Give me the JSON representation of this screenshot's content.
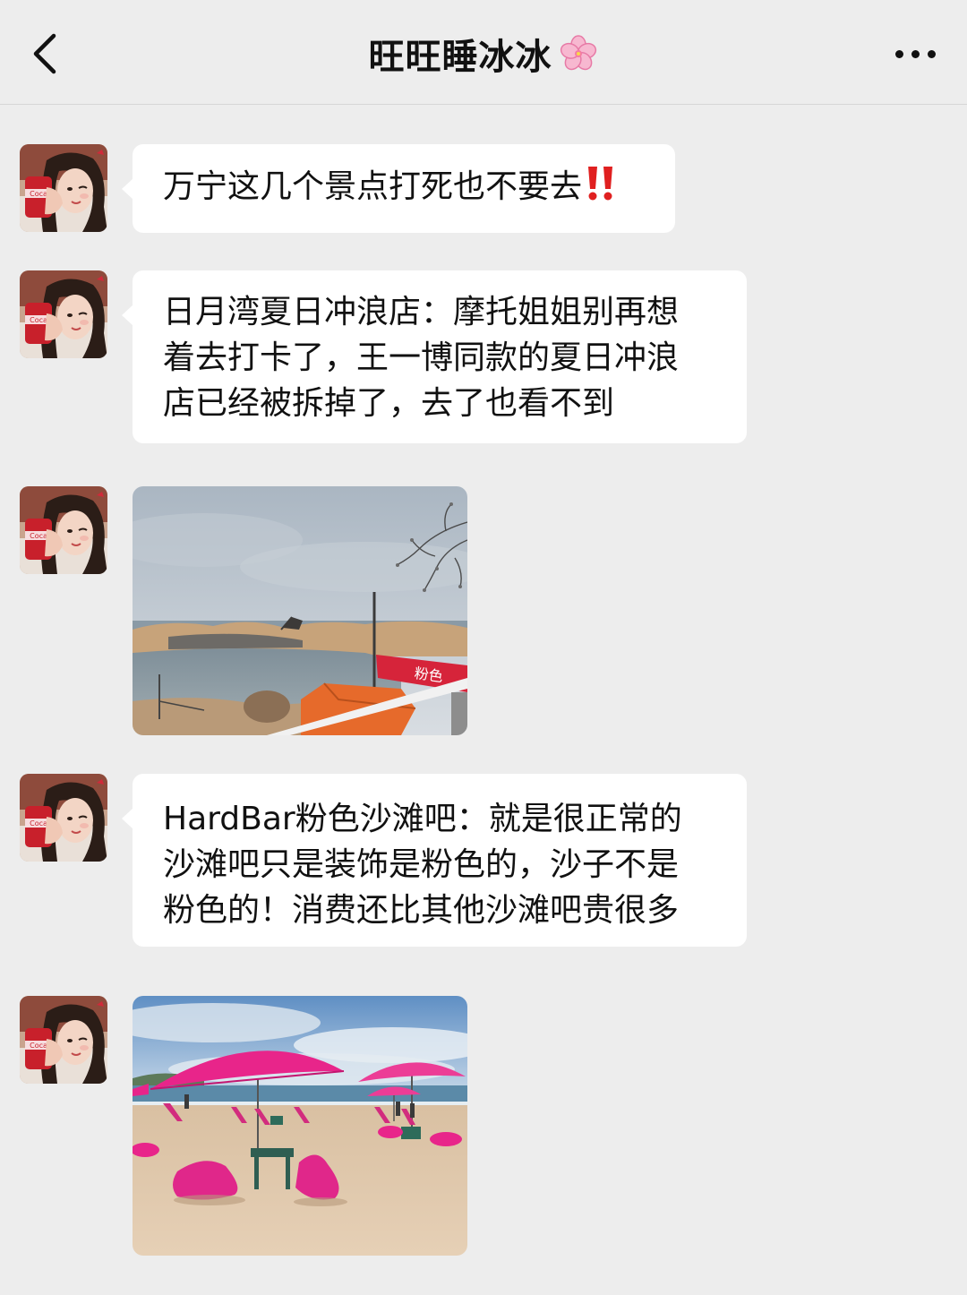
{
  "header": {
    "title": "旺旺睡冰冰",
    "back_icon": "chevron-left-icon",
    "title_emoji": "cherry-blossom-icon",
    "more_icon": "more-horizontal-icon"
  },
  "messages": [
    {
      "type": "text",
      "lines": [
        "万宁这几个景点打死也不要去"
      ],
      "trailing_icon": "double-exclamation-icon"
    },
    {
      "type": "text",
      "lines": [
        "日月湾夏日冲浪店：摩托姐姐别再想",
        "着去打卡了，王一博同款的夏日冲浪",
        "店已经被拆掉了，去了也看不到"
      ]
    },
    {
      "type": "image",
      "icon": "beach-construction-photo"
    },
    {
      "type": "text",
      "lines": [
        "HardBar粉色沙滩吧：就是很正常的",
        "沙滩吧只是装饰是粉色的，沙子不是",
        "粉色的！消费还比其他沙滩吧贵很多"
      ]
    },
    {
      "type": "image",
      "icon": "pink-beach-umbrellas-photo"
    }
  ],
  "colors": {
    "background": "#ededed",
    "bubble": "#ffffff",
    "text": "#111111",
    "warning": "#e02020",
    "pink": "#e8258a"
  }
}
